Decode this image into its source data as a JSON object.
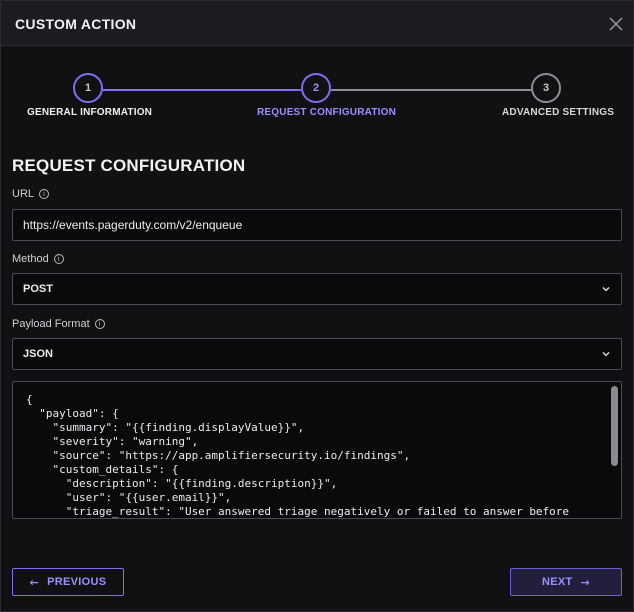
{
  "modal": {
    "title": "CUSTOM ACTION"
  },
  "stepper": {
    "steps": [
      {
        "number": "1",
        "label": "GENERAL INFORMATION",
        "state": "done"
      },
      {
        "number": "2",
        "label": "REQUEST CONFIGURATION",
        "state": "active"
      },
      {
        "number": "3",
        "label": "ADVANCED SETTINGS",
        "state": "pending"
      }
    ]
  },
  "section": {
    "title": "REQUEST CONFIGURATION"
  },
  "fields": {
    "url": {
      "label": "URL",
      "value": "https://events.pagerduty.com/v2/enqueue"
    },
    "method": {
      "label": "Method",
      "value": "POST"
    },
    "payload_format": {
      "label": "Payload Format",
      "value": "JSON"
    },
    "payload_body": "{\n  \"payload\": {\n    \"summary\": \"{{finding.displayValue}}\",\n    \"severity\": \"warning\",\n    \"source\": \"https://app.amplifiersecurity.io/findings\",\n    \"custom_details\": {\n      \"description\": \"{{finding.description}}\",\n      \"user\": \"{{user.email}}\",\n      \"triage_result\": \"User answered triage negatively or failed to answer before\ndeadline.\""
  },
  "footer": {
    "previous_label": "PREVIOUS",
    "next_label": "NEXT"
  },
  "icons": {
    "close": "close-icon",
    "info": "info-icon",
    "chevron": "chevron-down-icon",
    "arrow_left": "arrow-left-icon",
    "arrow_right": "arrow-right-icon"
  },
  "colors": {
    "accent": "#7d70f5",
    "accent_text": "#9a90ff",
    "background": "#111113",
    "header": "#1c1c20"
  }
}
